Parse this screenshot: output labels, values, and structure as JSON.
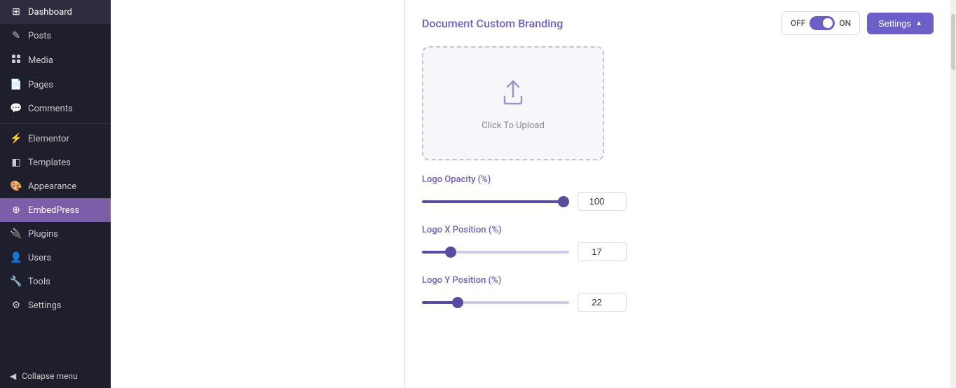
{
  "sidebar": {
    "items": [
      {
        "id": "dashboard",
        "label": "Dashboard",
        "icon": "⊞"
      },
      {
        "id": "posts",
        "label": "Posts",
        "icon": "✎"
      },
      {
        "id": "media",
        "label": "Media",
        "icon": "🖼"
      },
      {
        "id": "pages",
        "label": "Pages",
        "icon": "📄"
      },
      {
        "id": "comments",
        "label": "Comments",
        "icon": "💬"
      },
      {
        "id": "elementor",
        "label": "Elementor",
        "icon": "⚡"
      },
      {
        "id": "templates",
        "label": "Templates",
        "icon": "◧"
      },
      {
        "id": "appearance",
        "label": "Appearance",
        "icon": "🎨"
      },
      {
        "id": "embedpress",
        "label": "EmbedPress",
        "icon": "⊕"
      },
      {
        "id": "plugins",
        "label": "Plugins",
        "icon": "🔌"
      },
      {
        "id": "users",
        "label": "Users",
        "icon": "👤"
      },
      {
        "id": "tools",
        "label": "Tools",
        "icon": "🔧"
      },
      {
        "id": "settings",
        "label": "Settings",
        "icon": "⚙"
      }
    ],
    "collapse_label": "Collapse menu"
  },
  "header": {
    "title": "Document Custom Branding"
  },
  "toggle": {
    "off_label": "OFF",
    "on_label": "ON",
    "state": true
  },
  "settings_button": {
    "label": "Settings"
  },
  "upload": {
    "label": "Click To Upload"
  },
  "sliders": [
    {
      "id": "opacity",
      "label": "Logo Opacity (%)",
      "value": 100,
      "min": 0,
      "max": 100,
      "percent": 100
    },
    {
      "id": "x_position",
      "label": "Logo X Position (%)",
      "value": 17,
      "min": 0,
      "max": 100,
      "percent": 17
    },
    {
      "id": "y_position",
      "label": "Logo Y Position (%)",
      "value": 22,
      "min": 0,
      "max": 100,
      "percent": 22
    }
  ],
  "colors": {
    "sidebar_bg": "#1e1e2d",
    "active_bg": "#7b5ea7",
    "accent": "#6c5fc7",
    "button_bg": "#6c5fc7"
  }
}
